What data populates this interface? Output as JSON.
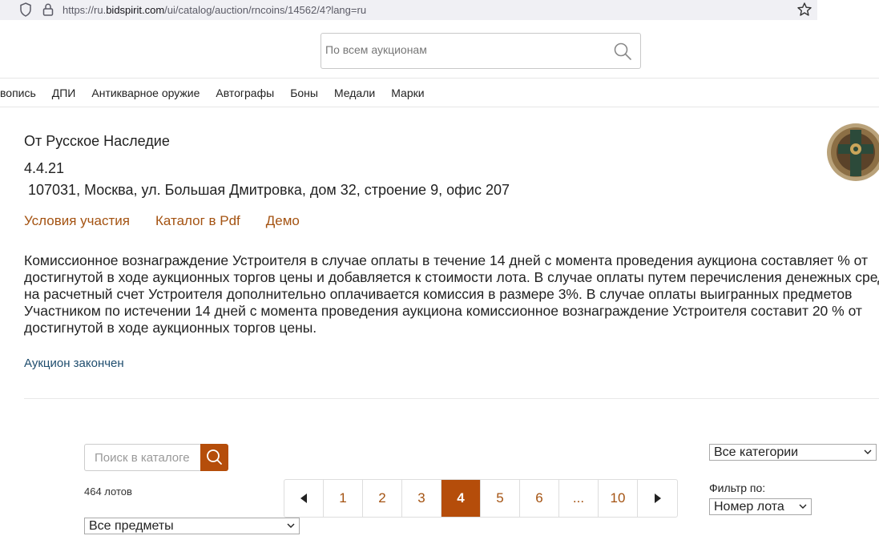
{
  "browser": {
    "url_prefix": "https://ru.",
    "url_domain": "bidspirit.com",
    "url_path": "/ui/catalog/auction/rncoins/14562/4?lang=ru"
  },
  "header": {
    "search_placeholder": "По всем аукционам"
  },
  "category_nav": [
    "вопись",
    "ДПИ",
    "Антикварное оружие",
    "Автографы",
    "Боны",
    "Медали",
    "Марки"
  ],
  "auction": {
    "seller": "От Русское Наследие",
    "date": "4.4.21",
    "address": " 107031, Москва, ул. Большая Дмитровка, дом 32, строение 9, офис 207",
    "links": {
      "terms": "Условия участия",
      "pdf": "Каталог в Pdf",
      "demo": "Демо"
    },
    "terms_text": "Комиссионное вознаграждение Устроителя в случае оплаты в течение 14 дней с момента проведения аукциона составляет % от достигнутой в ходе аукционных торгов цены и добавляется к стоимости лота. В случае оплаты путем перечисления денежных средств на расчетный счет Устроителя дополнительно оплачивается комиссия в размере 3%. В случае оплаты выигранных предметов Участником по истечении 14 дней с момента проведения аукциона комиссионное вознаграждение Устроителя составит 20 % от достигнутой в ходе аукционных торгов цены.",
    "status": "Аукцион закончен"
  },
  "catalog": {
    "search_placeholder": "Поиск в каталоге",
    "lot_count": "464 лотов",
    "items_select": "Все предметы",
    "categories_select": "Все категории",
    "filter_label": "Фильтр по:",
    "filter_select": "Номер лота"
  },
  "pagination": {
    "pages": [
      "1",
      "2",
      "3",
      "4",
      "5",
      "6",
      "...",
      "10"
    ],
    "current": "4"
  },
  "colors": {
    "accent": "#b54d0a",
    "link": "#a45312",
    "status": "#1f4d6e"
  }
}
